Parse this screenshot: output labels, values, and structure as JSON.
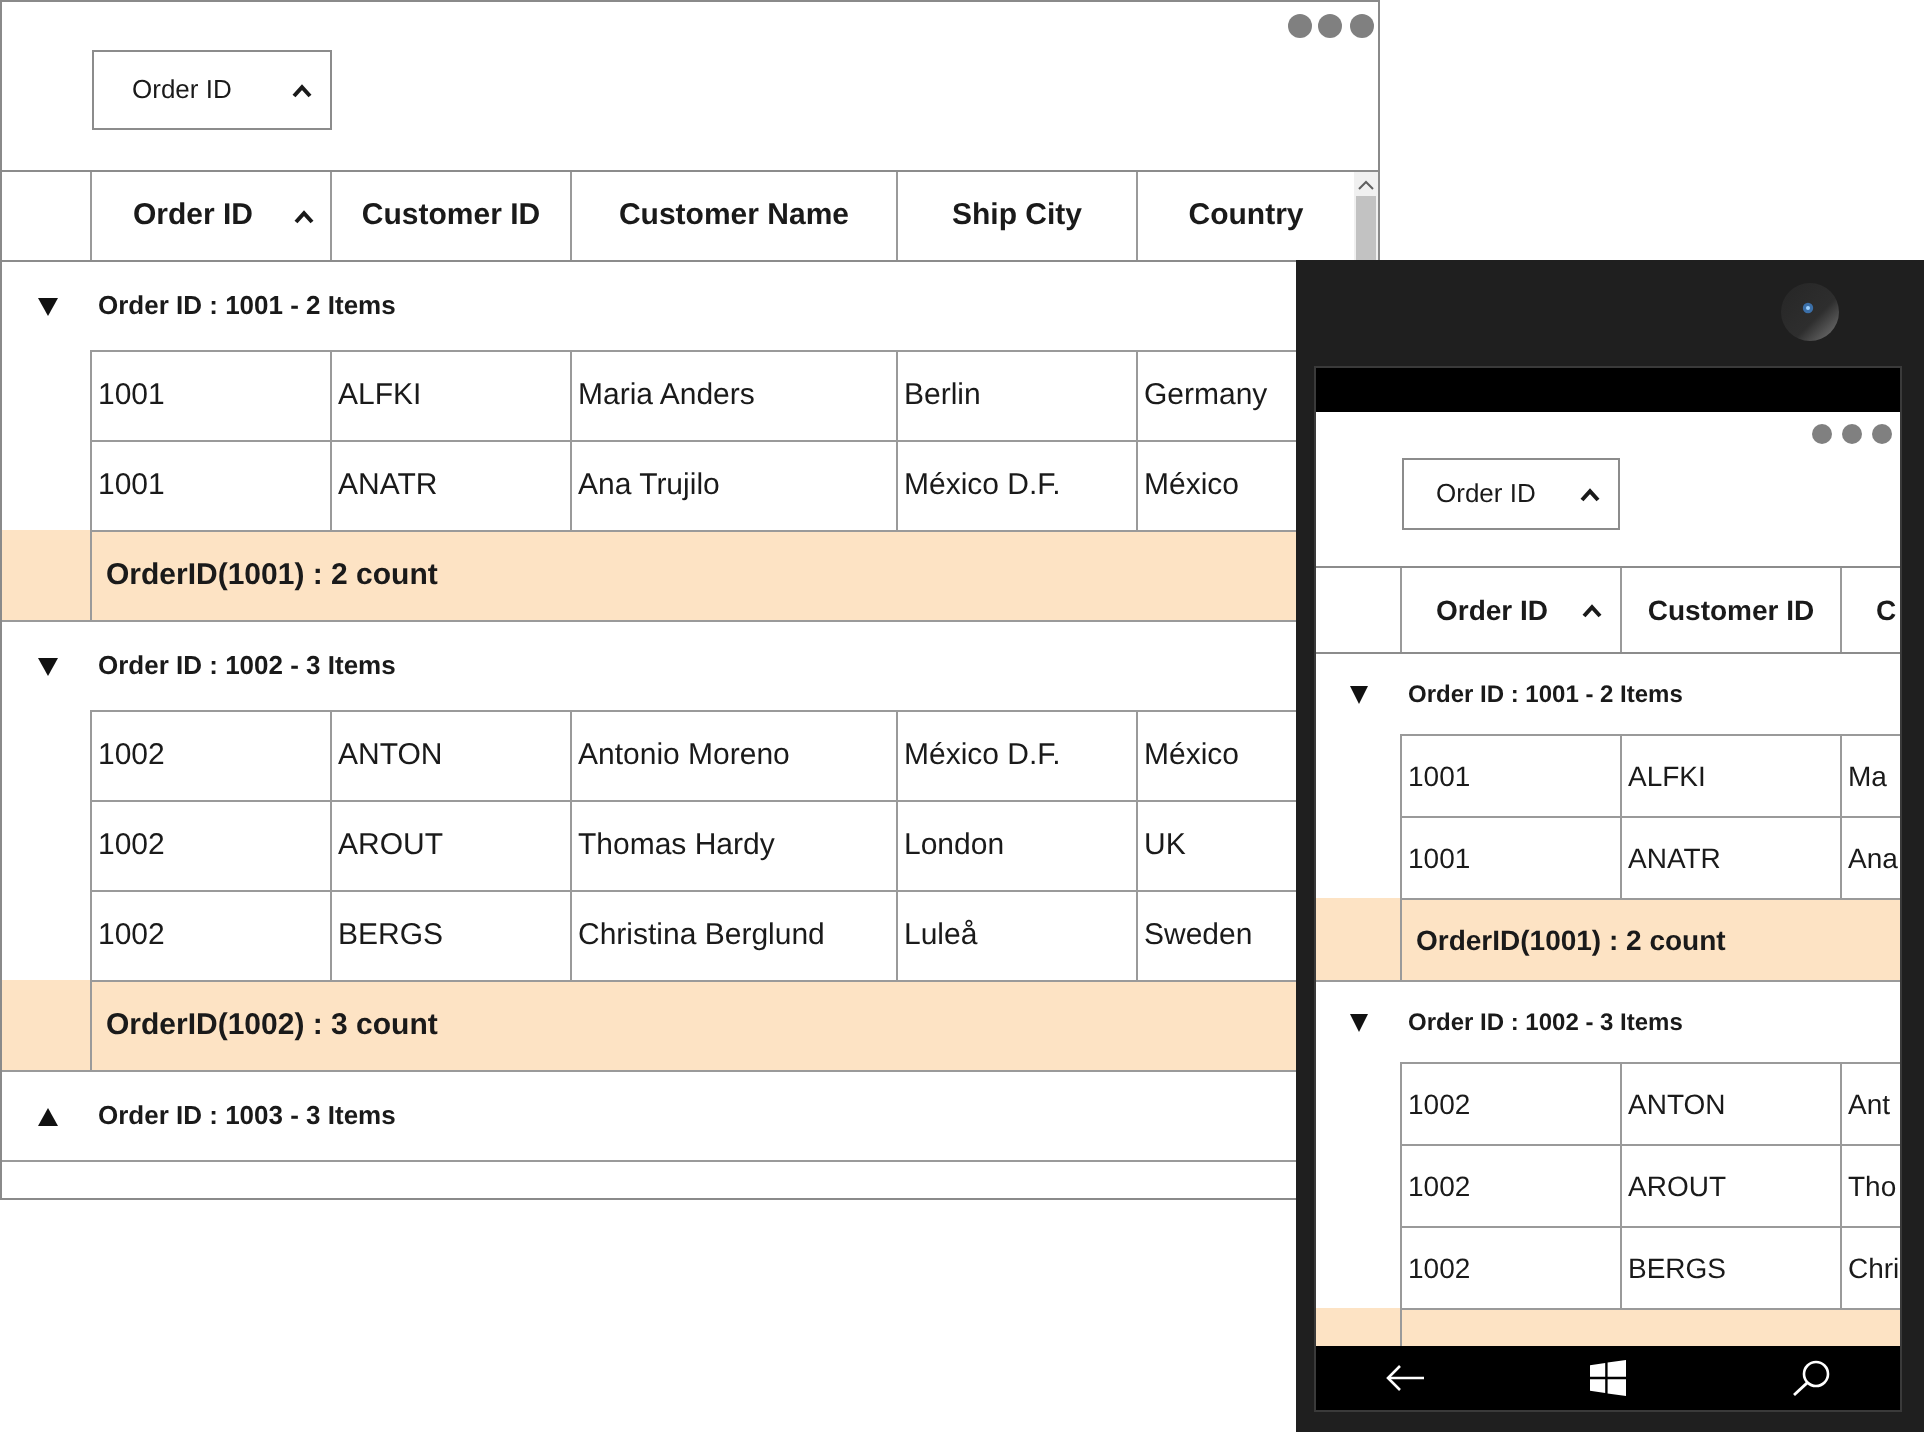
{
  "desktop_grid": {
    "group_drop_area": {
      "chips": [
        {
          "label": "Order ID",
          "sorted": true
        }
      ]
    },
    "columns": [
      {
        "label": "Order ID",
        "sorted": true
      },
      {
        "label": "Customer ID",
        "sorted": false
      },
      {
        "label": "Customer Name",
        "sorted": false
      },
      {
        "label": "Ship City",
        "sorted": false
      },
      {
        "label": "Country",
        "sorted": false
      }
    ],
    "groups": [
      {
        "caption": "Order ID : 1001 - 2 Items",
        "expanded": true,
        "rows": [
          {
            "kind": "record",
            "cells": [
              "1001",
              "ALFKI",
              "Maria Anders",
              "Berlin",
              "Germany"
            ]
          },
          {
            "kind": "record",
            "cells": [
              "1001",
              "ANATR",
              "Ana Trujilo",
              "México D.F.",
              "México"
            ]
          },
          {
            "kind": "summary",
            "text": "OrderID(1001) : 2 count"
          }
        ]
      },
      {
        "caption": "Order ID : 1002 - 3 Items",
        "expanded": true,
        "rows": [
          {
            "kind": "record",
            "cells": [
              "1002",
              "ANTON",
              "Antonio Moreno",
              "México D.F.",
              "México"
            ]
          },
          {
            "kind": "record",
            "cells": [
              "1002",
              "AROUT",
              "Thomas Hardy",
              "London",
              "UK"
            ]
          },
          {
            "kind": "record",
            "cells": [
              "1002",
              "BERGS",
              "Christina Berglund",
              "Luleå",
              "Sweden"
            ]
          },
          {
            "kind": "summary",
            "text": "OrderID(1002) : 3 count"
          }
        ]
      },
      {
        "caption": "Order ID : 1003 - 3 Items",
        "expanded": false
      }
    ]
  },
  "phone_grid": {
    "group_drop_area": {
      "chips": [
        {
          "label": "Order ID",
          "sorted": true
        }
      ]
    },
    "columns": [
      {
        "label": "Order ID",
        "sorted": true
      },
      {
        "label": "Customer ID",
        "sorted": false
      },
      {
        "label": "C",
        "sorted": false
      }
    ],
    "groups": [
      {
        "caption": "Order ID : 1001 - 2 Items",
        "expanded": true,
        "rows": [
          {
            "kind": "record",
            "cells": [
              "1001",
              "ALFKI",
              "Ma"
            ]
          },
          {
            "kind": "record",
            "cells": [
              "1001",
              "ANATR",
              "Ana"
            ]
          },
          {
            "kind": "summary",
            "text": "OrderID(1001) : 2 count"
          }
        ]
      },
      {
        "caption": "Order ID : 1002 - 3 Items",
        "expanded": true,
        "rows": [
          {
            "kind": "record",
            "cells": [
              "1002",
              "ANTON",
              "Ant"
            ]
          },
          {
            "kind": "record",
            "cells": [
              "1002",
              "AROUT",
              "Tho"
            ]
          },
          {
            "kind": "record",
            "cells": [
              "1002",
              "BERGS",
              "Chri"
            ]
          },
          {
            "kind": "summary"
          }
        ]
      }
    ]
  }
}
